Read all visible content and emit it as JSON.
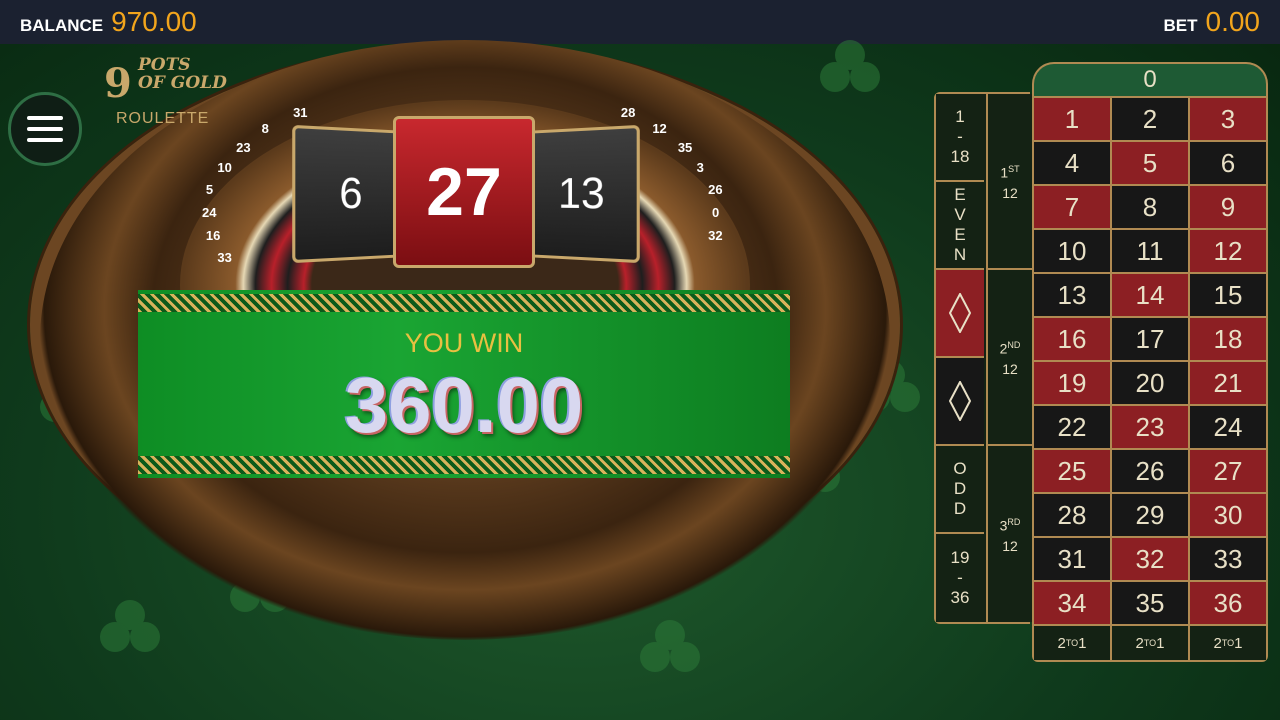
{
  "topbar": {
    "balance_label": "BALANCE",
    "balance_value": "970.00",
    "bet_label": "BET",
    "bet_value": "0.00"
  },
  "logo": {
    "nine": "9",
    "pots": "POTS",
    "of_gold": "OF GOLD",
    "subtitle": "ROULETTE"
  },
  "result": {
    "previous": "6",
    "winning": "27",
    "next": "13"
  },
  "win": {
    "title": "YOU WIN",
    "amount": "360.00"
  },
  "table": {
    "zero": "0",
    "numbers": [
      {
        "n": "1",
        "c": "red"
      },
      {
        "n": "2",
        "c": "black"
      },
      {
        "n": "3",
        "c": "red"
      },
      {
        "n": "4",
        "c": "black"
      },
      {
        "n": "5",
        "c": "red"
      },
      {
        "n": "6",
        "c": "black"
      },
      {
        "n": "7",
        "c": "red"
      },
      {
        "n": "8",
        "c": "black"
      },
      {
        "n": "9",
        "c": "red"
      },
      {
        "n": "10",
        "c": "black"
      },
      {
        "n": "11",
        "c": "black"
      },
      {
        "n": "12",
        "c": "red"
      },
      {
        "n": "13",
        "c": "black"
      },
      {
        "n": "14",
        "c": "red"
      },
      {
        "n": "15",
        "c": "black"
      },
      {
        "n": "16",
        "c": "red"
      },
      {
        "n": "17",
        "c": "black"
      },
      {
        "n": "18",
        "c": "red"
      },
      {
        "n": "19",
        "c": "red"
      },
      {
        "n": "20",
        "c": "black"
      },
      {
        "n": "21",
        "c": "red"
      },
      {
        "n": "22",
        "c": "black"
      },
      {
        "n": "23",
        "c": "red"
      },
      {
        "n": "24",
        "c": "black"
      },
      {
        "n": "25",
        "c": "red"
      },
      {
        "n": "26",
        "c": "black"
      },
      {
        "n": "27",
        "c": "red"
      },
      {
        "n": "28",
        "c": "black"
      },
      {
        "n": "29",
        "c": "black"
      },
      {
        "n": "30",
        "c": "red"
      },
      {
        "n": "31",
        "c": "black"
      },
      {
        "n": "32",
        "c": "red"
      },
      {
        "n": "33",
        "c": "black"
      },
      {
        "n": "34",
        "c": "red"
      },
      {
        "n": "35",
        "c": "black"
      },
      {
        "n": "36",
        "c": "red"
      }
    ],
    "columns": [
      "2",
      "TO",
      "1"
    ],
    "dozens": [
      {
        "num": "1",
        "sup": "ST",
        "label": "12"
      },
      {
        "num": "2",
        "sup": "ND",
        "label": "12"
      },
      {
        "num": "3",
        "sup": "RD",
        "label": "12"
      }
    ],
    "outside": {
      "low": [
        "1",
        "-",
        "18"
      ],
      "even": [
        "E",
        "V",
        "E",
        "N"
      ],
      "odd": [
        "O",
        "D",
        "D"
      ],
      "high": [
        "19",
        "-",
        "36"
      ]
    }
  },
  "wheel_numbers": [
    "33",
    "16",
    "24",
    "5",
    "10",
    "23",
    "8",
    "31",
    "28",
    "12",
    "35",
    "3",
    "26",
    "0",
    "32"
  ],
  "colors": {
    "accent": "#f2a51c",
    "red": "#8c1f23",
    "black": "#171717",
    "gold": "#b08a52"
  }
}
